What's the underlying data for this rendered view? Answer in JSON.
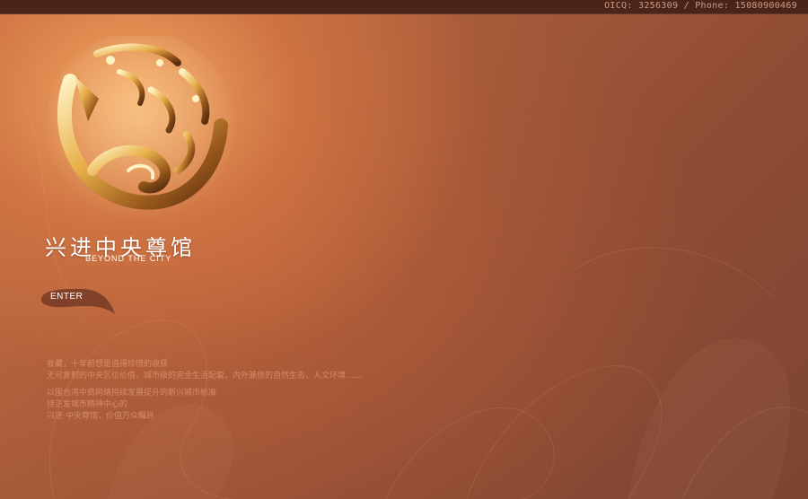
{
  "header": {
    "contact": "OICQ: 3256309 / Phone: 15080900469"
  },
  "brand": {
    "name_cn": "兴进中央尊馆",
    "name_en": "BEYOND THE CITY"
  },
  "nav": {
    "enter_label": "ENTER"
  },
  "description": {
    "lines": [
      "收藏，十年前想是值得珍惜的收获",
      "无可复制的中央区位价值，城市级的完全生活配套，内外兼修的自然生态，人文环境……",
      "以国台湾中商网络持续发展提升的新兴城市标准",
      "持正发城市精神中心的",
      "兴进·中央尊馆，价值万众瞩目"
    ]
  },
  "colors": {
    "topbar": "#4a2418",
    "background_dark": "#7d4532",
    "background_light": "#f6aa62",
    "logo_gold": "#e8b04a"
  }
}
